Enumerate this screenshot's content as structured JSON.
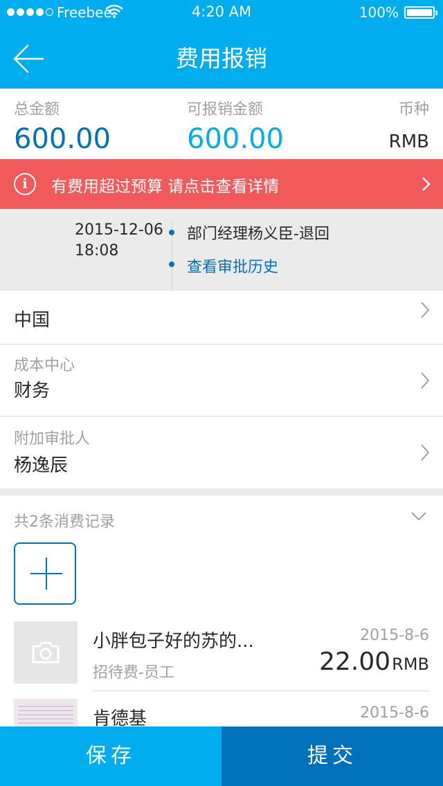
{
  "status_bar": {
    "carrier": "Freebee",
    "time": "4:20 AM",
    "battery": "100%"
  },
  "nav": {
    "title": "费用报销"
  },
  "summary": {
    "total_label": "总金额",
    "total_value": "600.00",
    "available_label": "可报销金额",
    "available_value": "600.00",
    "currency_label": "币种",
    "currency_value": "RMB"
  },
  "banner": {
    "text": "有费用超过预算  请点击查看详情"
  },
  "approval": {
    "date": "2015-12-06",
    "time": "18:08",
    "status": "部门经理杨义臣-退回",
    "history_link": "查看审批历史"
  },
  "fields": {
    "project_value": "中国",
    "cost_center_label": "成本中心",
    "cost_center_value": "财务",
    "approver_label": "附加审批人",
    "approver_value": "杨逸辰"
  },
  "records": {
    "header": "共2条消费记录",
    "items": [
      {
        "title": "小胖包子好的苏的...",
        "date": "2015-8-6",
        "category": "招待费-员工",
        "amount": "22.00",
        "currency": "RMB"
      },
      {
        "title": "肯德基",
        "date": "2015-8-6"
      }
    ]
  },
  "actions": {
    "save": "保存",
    "submit": "提交"
  },
  "colors": {
    "primary_blue": "#00adef",
    "dark_blue": "#0072bc",
    "alert_red": "#f05a5a",
    "text_dark": "#282828",
    "text_gray": "#a0a0a0"
  }
}
